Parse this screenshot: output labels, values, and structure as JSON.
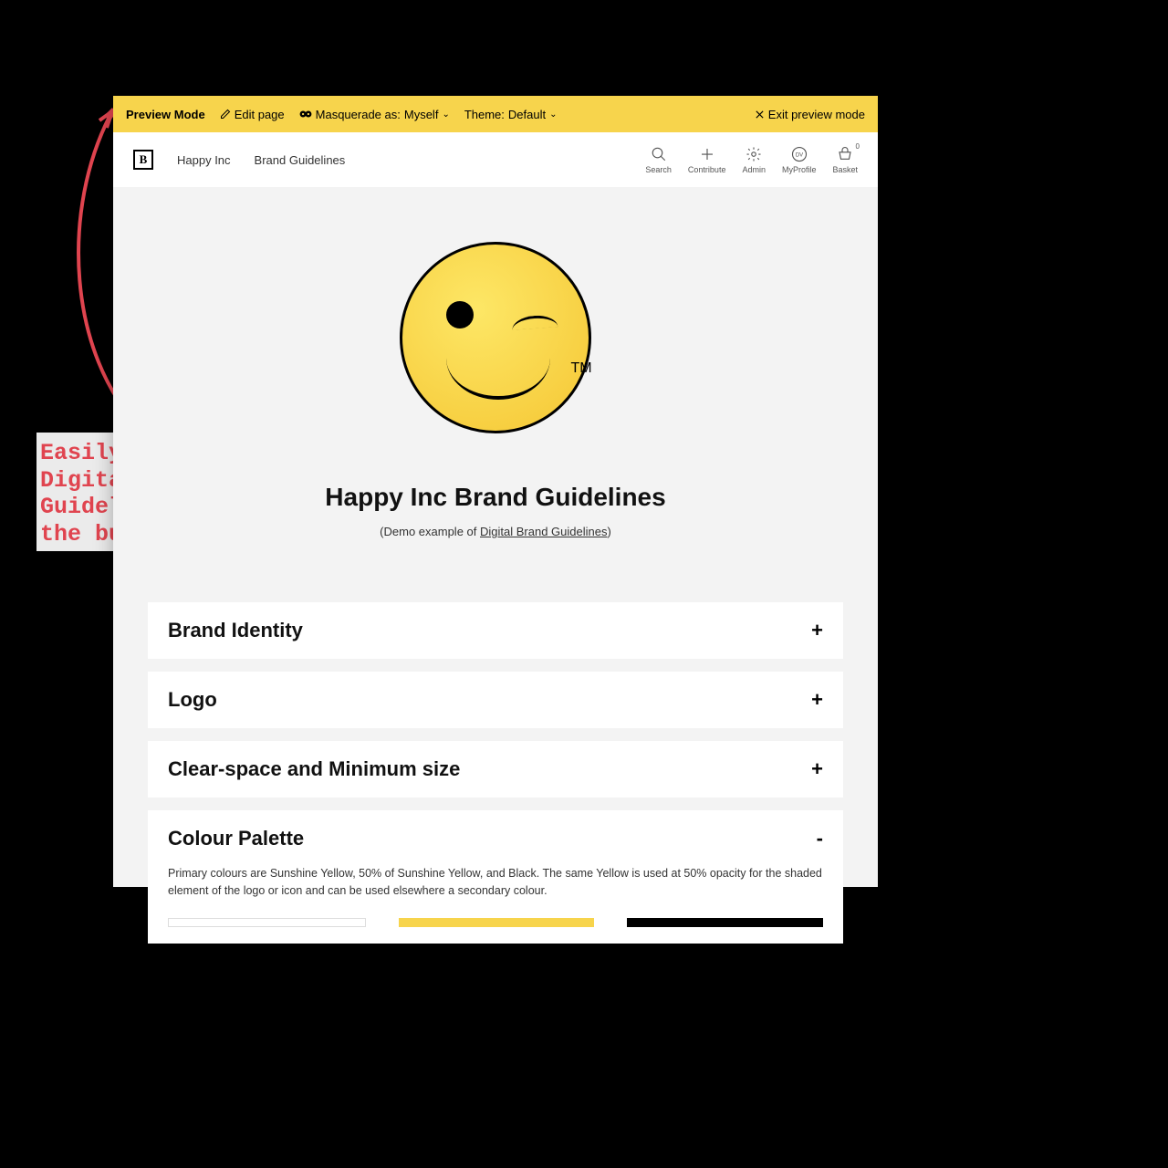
{
  "previewBar": {
    "modeLabel": "Preview Mode",
    "editPage": "Edit page",
    "masqueradePrefix": "Masquerade as:",
    "masqueradeValue": "Myself",
    "themePrefix": "Theme:",
    "themeValue": "Default",
    "exit": "Exit preview mode"
  },
  "topNav": {
    "brand": "Happy Inc",
    "crumb": "Brand Guidelines",
    "items": [
      {
        "label": "Search"
      },
      {
        "label": "Contribute"
      },
      {
        "label": "Admin"
      },
      {
        "label": "MyProfile"
      },
      {
        "label": "Basket"
      }
    ],
    "basketCount": "0",
    "avatarInitials": "DV"
  },
  "hero": {
    "trademark": "TM",
    "title": "Happy Inc Brand Guidelines",
    "subtitlePrefix": "(Demo example of ",
    "subtitleLink": "Digital Brand Guidelines",
    "subtitleSuffix": ")"
  },
  "accordion": [
    {
      "title": "Brand Identity",
      "toggle": "+"
    },
    {
      "title": "Logo",
      "toggle": "+"
    },
    {
      "title": "Clear-space and Minimum size",
      "toggle": "+"
    },
    {
      "title": "Colour Palette",
      "toggle": "-",
      "body": "Primary colours are Sunshine Yellow, 50% of Sunshine Yellow, and Black. The same Yellow is used at 50% opacity for the shaded element of the logo or icon and can be used elsewhere a secondary colour."
    }
  ],
  "annotation": "Easily edit your Digital Brand Guidelines with the built in CMS",
  "colors": {
    "accentYellow": "#f7d44c",
    "annotationRed": "#e0444f"
  }
}
